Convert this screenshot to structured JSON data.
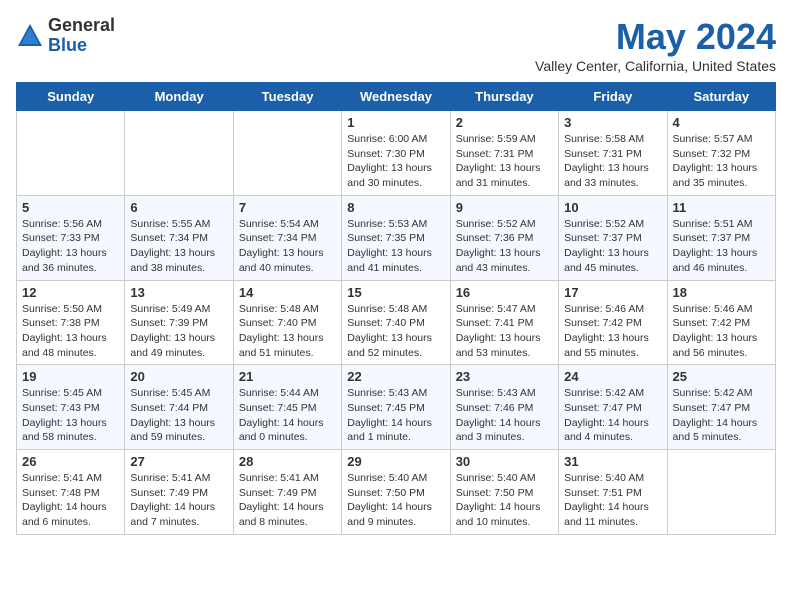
{
  "header": {
    "logo": {
      "general": "General",
      "blue": "Blue"
    },
    "title": "May 2024",
    "location": "Valley Center, California, United States"
  },
  "weekdays": [
    "Sunday",
    "Monday",
    "Tuesday",
    "Wednesday",
    "Thursday",
    "Friday",
    "Saturday"
  ],
  "weeks": [
    [
      {
        "day": "",
        "info": ""
      },
      {
        "day": "",
        "info": ""
      },
      {
        "day": "",
        "info": ""
      },
      {
        "day": "1",
        "info": "Sunrise: 6:00 AM\nSunset: 7:30 PM\nDaylight: 13 hours\nand 30 minutes."
      },
      {
        "day": "2",
        "info": "Sunrise: 5:59 AM\nSunset: 7:31 PM\nDaylight: 13 hours\nand 31 minutes."
      },
      {
        "day": "3",
        "info": "Sunrise: 5:58 AM\nSunset: 7:31 PM\nDaylight: 13 hours\nand 33 minutes."
      },
      {
        "day": "4",
        "info": "Sunrise: 5:57 AM\nSunset: 7:32 PM\nDaylight: 13 hours\nand 35 minutes."
      }
    ],
    [
      {
        "day": "5",
        "info": "Sunrise: 5:56 AM\nSunset: 7:33 PM\nDaylight: 13 hours\nand 36 minutes."
      },
      {
        "day": "6",
        "info": "Sunrise: 5:55 AM\nSunset: 7:34 PM\nDaylight: 13 hours\nand 38 minutes."
      },
      {
        "day": "7",
        "info": "Sunrise: 5:54 AM\nSunset: 7:34 PM\nDaylight: 13 hours\nand 40 minutes."
      },
      {
        "day": "8",
        "info": "Sunrise: 5:53 AM\nSunset: 7:35 PM\nDaylight: 13 hours\nand 41 minutes."
      },
      {
        "day": "9",
        "info": "Sunrise: 5:52 AM\nSunset: 7:36 PM\nDaylight: 13 hours\nand 43 minutes."
      },
      {
        "day": "10",
        "info": "Sunrise: 5:52 AM\nSunset: 7:37 PM\nDaylight: 13 hours\nand 45 minutes."
      },
      {
        "day": "11",
        "info": "Sunrise: 5:51 AM\nSunset: 7:37 PM\nDaylight: 13 hours\nand 46 minutes."
      }
    ],
    [
      {
        "day": "12",
        "info": "Sunrise: 5:50 AM\nSunset: 7:38 PM\nDaylight: 13 hours\nand 48 minutes."
      },
      {
        "day": "13",
        "info": "Sunrise: 5:49 AM\nSunset: 7:39 PM\nDaylight: 13 hours\nand 49 minutes."
      },
      {
        "day": "14",
        "info": "Sunrise: 5:48 AM\nSunset: 7:40 PM\nDaylight: 13 hours\nand 51 minutes."
      },
      {
        "day": "15",
        "info": "Sunrise: 5:48 AM\nSunset: 7:40 PM\nDaylight: 13 hours\nand 52 minutes."
      },
      {
        "day": "16",
        "info": "Sunrise: 5:47 AM\nSunset: 7:41 PM\nDaylight: 13 hours\nand 53 minutes."
      },
      {
        "day": "17",
        "info": "Sunrise: 5:46 AM\nSunset: 7:42 PM\nDaylight: 13 hours\nand 55 minutes."
      },
      {
        "day": "18",
        "info": "Sunrise: 5:46 AM\nSunset: 7:42 PM\nDaylight: 13 hours\nand 56 minutes."
      }
    ],
    [
      {
        "day": "19",
        "info": "Sunrise: 5:45 AM\nSunset: 7:43 PM\nDaylight: 13 hours\nand 58 minutes."
      },
      {
        "day": "20",
        "info": "Sunrise: 5:45 AM\nSunset: 7:44 PM\nDaylight: 13 hours\nand 59 minutes."
      },
      {
        "day": "21",
        "info": "Sunrise: 5:44 AM\nSunset: 7:45 PM\nDaylight: 14 hours\nand 0 minutes."
      },
      {
        "day": "22",
        "info": "Sunrise: 5:43 AM\nSunset: 7:45 PM\nDaylight: 14 hours\nand 1 minute."
      },
      {
        "day": "23",
        "info": "Sunrise: 5:43 AM\nSunset: 7:46 PM\nDaylight: 14 hours\nand 3 minutes."
      },
      {
        "day": "24",
        "info": "Sunrise: 5:42 AM\nSunset: 7:47 PM\nDaylight: 14 hours\nand 4 minutes."
      },
      {
        "day": "25",
        "info": "Sunrise: 5:42 AM\nSunset: 7:47 PM\nDaylight: 14 hours\nand 5 minutes."
      }
    ],
    [
      {
        "day": "26",
        "info": "Sunrise: 5:41 AM\nSunset: 7:48 PM\nDaylight: 14 hours\nand 6 minutes."
      },
      {
        "day": "27",
        "info": "Sunrise: 5:41 AM\nSunset: 7:49 PM\nDaylight: 14 hours\nand 7 minutes."
      },
      {
        "day": "28",
        "info": "Sunrise: 5:41 AM\nSunset: 7:49 PM\nDaylight: 14 hours\nand 8 minutes."
      },
      {
        "day": "29",
        "info": "Sunrise: 5:40 AM\nSunset: 7:50 PM\nDaylight: 14 hours\nand 9 minutes."
      },
      {
        "day": "30",
        "info": "Sunrise: 5:40 AM\nSunset: 7:50 PM\nDaylight: 14 hours\nand 10 minutes."
      },
      {
        "day": "31",
        "info": "Sunrise: 5:40 AM\nSunset: 7:51 PM\nDaylight: 14 hours\nand 11 minutes."
      },
      {
        "day": "",
        "info": ""
      }
    ]
  ]
}
